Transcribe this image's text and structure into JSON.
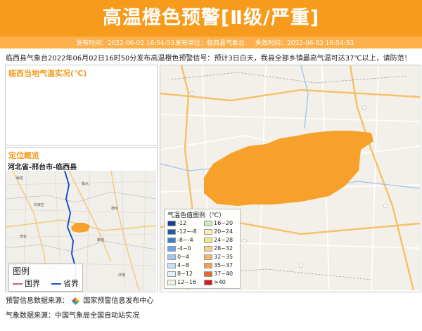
{
  "header": {
    "title": "高温橙色预警[Ⅱ级/严重]",
    "issue_time": "发布时间：2022-06-02 16:54:53",
    "issuer": "发布单位：临西县气象台",
    "expire_time": "失效时间：2022-06-03 16:54:53"
  },
  "description": "临西县气象台2022年06月02日16时50分发布高温橙色预警信号：预计3日白天，我县全部乡镇最高气温可达37℃以上，请防范！",
  "panels": {
    "realtime_title": "临西当地气温实况(℃)",
    "location_title": "定位概览",
    "location_path": "河北省-邢台市-临西县"
  },
  "left_legend": {
    "title": "图例",
    "items": [
      {
        "label": "国界",
        "color": "#c0667a"
      },
      {
        "label": "省界",
        "color": "#1f4fc8"
      }
    ]
  },
  "temp_legend": {
    "title": "气温色值图例（℃）",
    "items": [
      {
        "label": "-12",
        "color": "#1a3d8f"
      },
      {
        "label": "-12~-8",
        "color": "#2557ab"
      },
      {
        "label": "-8~-4",
        "color": "#3f7fd1"
      },
      {
        "label": "-4~0",
        "color": "#6aa6e8"
      },
      {
        "label": "0~4",
        "color": "#9cc8f0"
      },
      {
        "label": "4~8",
        "color": "#c4e0f7"
      },
      {
        "label": "8~12",
        "color": "#e2effa"
      },
      {
        "label": "12~16",
        "color": "#eaf6e4"
      },
      {
        "label": "16~20",
        "color": "#d0ebbe"
      },
      {
        "label": "20~24",
        "color": "#f5f2b4"
      },
      {
        "label": "24~28",
        "color": "#f7e68a"
      },
      {
        "label": "28~32",
        "color": "#f9cf8e"
      },
      {
        "label": "32~35",
        "color": "#f7b46c"
      },
      {
        "label": "35~37",
        "color": "#f59f4e"
      },
      {
        "label": "37~40",
        "color": "#e8662f"
      },
      {
        "label": ">40",
        "color": "#d41a1a"
      }
    ]
  },
  "footer": {
    "source_label": "预警信息数据来源：",
    "source_name": "国家预警信息发布中心",
    "weather_source": "气象数据来源：中国气象局全国自动站实况"
  },
  "colors": {
    "header_orange": "#f79b1d",
    "subbar_orange": "#fbb04b",
    "warning_area": "#f7a12a"
  }
}
